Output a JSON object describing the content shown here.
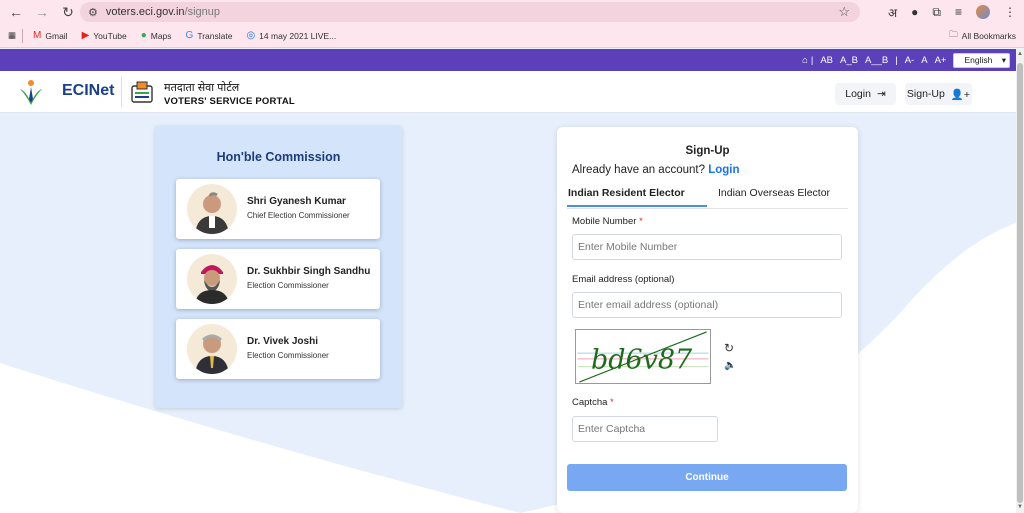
{
  "browser": {
    "url_host": "voters.eci.gov.in",
    "url_path": "/signup",
    "bookmarks": [
      {
        "label": "Gmail",
        "icon": "gmail-icon"
      },
      {
        "label": "YouTube",
        "icon": "youtube-icon"
      },
      {
        "label": "Maps",
        "icon": "maps-icon"
      },
      {
        "label": "Translate",
        "icon": "translate-icon"
      },
      {
        "label": "14 may 2021 LIVE...",
        "icon": "globe-icon"
      }
    ],
    "all_bookmarks": "All Bookmarks"
  },
  "strip": {
    "font_sizes": [
      "AB",
      "A_B",
      "A__B"
    ],
    "text_sizes": [
      "A-",
      "A",
      "A+"
    ],
    "language": "English"
  },
  "header": {
    "eci_name": "ECINet",
    "portal_hindi": "मतदाता सेवा पोर्टल",
    "portal_en": "VOTERS' SERVICE PORTAL",
    "login": "Login",
    "signup": "Sign-Up"
  },
  "commission": {
    "title": "Hon'ble Commission",
    "members": [
      {
        "name": "Shri Gyanesh Kumar",
        "role": "Chief Election Commissioner"
      },
      {
        "name": "Dr. Sukhbir Singh Sandhu",
        "role": "Election Commissioner"
      },
      {
        "name": "Dr. Vivek Joshi",
        "role": "Election Commissioner"
      }
    ]
  },
  "signup": {
    "title": "Sign-Up",
    "already": "Already have an account?",
    "login_link": "Login",
    "tab_resident": "Indian Resident Elector",
    "tab_overseas": "Indian Overseas Elector",
    "mobile_label": "Mobile Number",
    "mobile_placeholder": "Enter Mobile Number",
    "email_label": "Email address (optional)",
    "email_placeholder": "Enter email address (optional)",
    "captcha_text": "bd6v87",
    "captcha_label": "Captcha",
    "captcha_placeholder": "Enter Captcha",
    "required_mark": "*",
    "continue": "Continue"
  },
  "colors": {
    "strip": "#5b40b9",
    "primary_blue": "#1a73e8",
    "continue_button": "#78a8f2",
    "commission_bg": "#d3e4fb"
  }
}
